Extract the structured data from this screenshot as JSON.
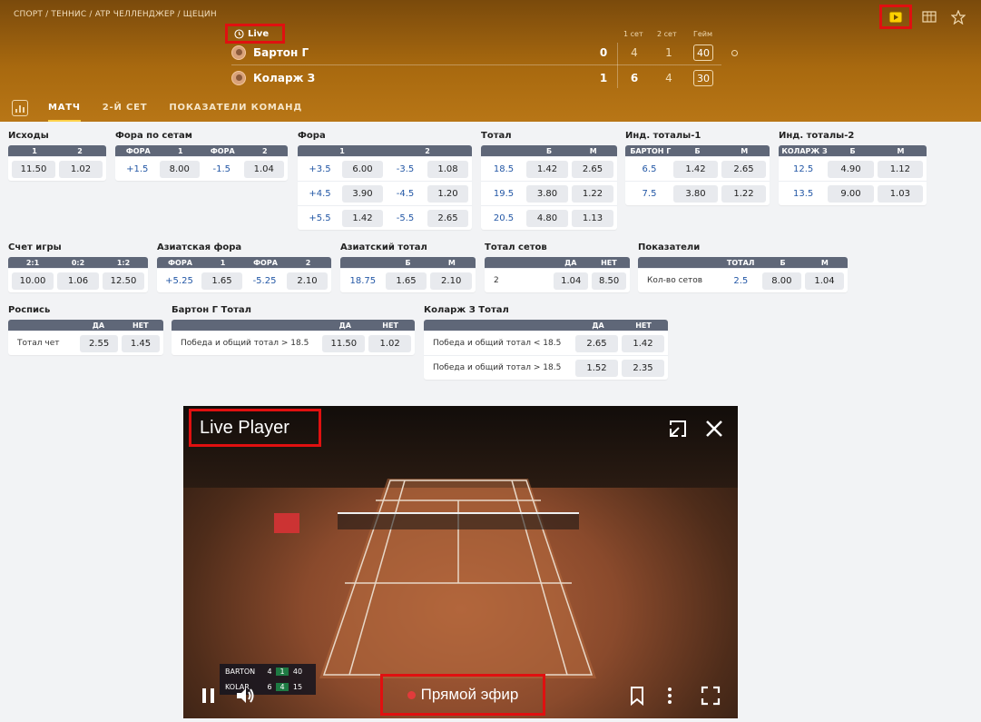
{
  "breadcrumb": "СПОРТ / ТЕННИС / ATP ЧЕЛЛЕНДЖЕР / ЩЕЦИН",
  "live_label": "Live",
  "scoreboard": {
    "headers": {
      "set1": "1 сет",
      "set2": "2 сет",
      "game": "Гейм"
    },
    "players": [
      {
        "name": "Бартон Г",
        "sets": "0",
        "set1": "4",
        "set2": "1",
        "game": "40",
        "serving": true
      },
      {
        "name": "Коларж З",
        "sets": "1",
        "set1": "6",
        "set2": "4",
        "game": "30",
        "serving": false
      }
    ]
  },
  "tabs": [
    "МАТЧ",
    "2-Й СЕТ",
    "ПОКАЗАТЕЛИ КОМАНД"
  ],
  "markets": {
    "ishody": {
      "title": "Исходы",
      "head": [
        "1",
        "2"
      ],
      "rows": [
        [
          "11.50",
          "1.02"
        ]
      ]
    },
    "fora_sets": {
      "title": "Фора по сетам",
      "head": [
        "ФОРА",
        "1",
        "ФОРА",
        "2"
      ],
      "rows": [
        [
          "+1.5",
          "8.00",
          "-1.5",
          "1.04"
        ]
      ]
    },
    "fora": {
      "title": "Фора",
      "head": [
        "1",
        "2"
      ],
      "rows": [
        [
          "+3.5",
          "6.00",
          "-3.5",
          "1.08"
        ],
        [
          "+4.5",
          "3.90",
          "-4.5",
          "1.20"
        ],
        [
          "+5.5",
          "1.42",
          "-5.5",
          "2.65"
        ]
      ]
    },
    "total": {
      "title": "Тотал",
      "head": [
        "Б",
        "М"
      ],
      "rows": [
        [
          "18.5",
          "1.42",
          "2.65"
        ],
        [
          "19.5",
          "3.80",
          "1.22"
        ],
        [
          "20.5",
          "4.80",
          "1.13"
        ]
      ]
    },
    "ind1": {
      "title": "Инд. тоталы-1",
      "head": [
        "БАРТОН Г",
        "Б",
        "М"
      ],
      "rows": [
        [
          "6.5",
          "1.42",
          "2.65"
        ],
        [
          "7.5",
          "3.80",
          "1.22"
        ]
      ]
    },
    "ind2": {
      "title": "Инд. тоталы-2",
      "head": [
        "КОЛАРЖ З",
        "Б",
        "М"
      ],
      "rows": [
        [
          "12.5",
          "4.90",
          "1.12"
        ],
        [
          "13.5",
          "9.00",
          "1.03"
        ]
      ]
    },
    "schet": {
      "title": "Счет игры",
      "head": [
        "2:1",
        "0:2",
        "1:2"
      ],
      "rows": [
        [
          "10.00",
          "1.06",
          "12.50"
        ]
      ]
    },
    "asia_fora": {
      "title": "Азиатская фора",
      "head": [
        "ФОРА",
        "1",
        "ФОРА",
        "2"
      ],
      "rows": [
        [
          "+5.25",
          "1.65",
          "-5.25",
          "2.10"
        ]
      ]
    },
    "asia_total": {
      "title": "Азиатский тотал",
      "head": [
        "Б",
        "М"
      ],
      "rows": [
        [
          "18.75",
          "1.65",
          "2.10"
        ]
      ]
    },
    "total_sets": {
      "title": "Тотал сетов",
      "head": [
        "ДА",
        "НЕТ"
      ],
      "rows": [
        [
          "2",
          "1.04",
          "8.50"
        ]
      ]
    },
    "pokazateli": {
      "title": "Показатели",
      "head": [
        "ТОТАЛ",
        "Б",
        "М"
      ],
      "rows": [
        [
          "Кол-во сетов",
          "2.5",
          "8.00",
          "1.04"
        ]
      ]
    },
    "rospis": {
      "title": "Роспись",
      "head": [
        "ДА",
        "НЕТ"
      ],
      "rows": [
        [
          "Тотал чет",
          "2.55",
          "1.45"
        ]
      ]
    },
    "barton_total": {
      "title": "Бартон Г Тотал",
      "head": [
        "ДА",
        "НЕТ"
      ],
      "rows": [
        [
          "Победа и общий тотал > 18.5",
          "11.50",
          "1.02"
        ]
      ]
    },
    "kolar_total": {
      "title": "Коларж З Тотал",
      "head": [
        "ДА",
        "НЕТ"
      ],
      "rows": [
        [
          "Победа и общий тотал < 18.5",
          "2.65",
          "1.42"
        ],
        [
          "Победа и общий тотал > 18.5",
          "1.52",
          "2.35"
        ]
      ]
    }
  },
  "player": {
    "title": "Live Player",
    "live_text": "Прямой эфир",
    "mini_score": [
      {
        "name": "BARTON",
        "s1": "4",
        "s2": "1",
        "g": "40"
      },
      {
        "name": "KOLAR",
        "s1": "6",
        "s2": "4",
        "g": "15"
      }
    ]
  },
  "colors": {
    "accent": "#b87616",
    "header_dark": "#5f6778",
    "highlight": "#e01010",
    "tab_underline": "#ffd24a",
    "line_blue": "#2458a6"
  }
}
